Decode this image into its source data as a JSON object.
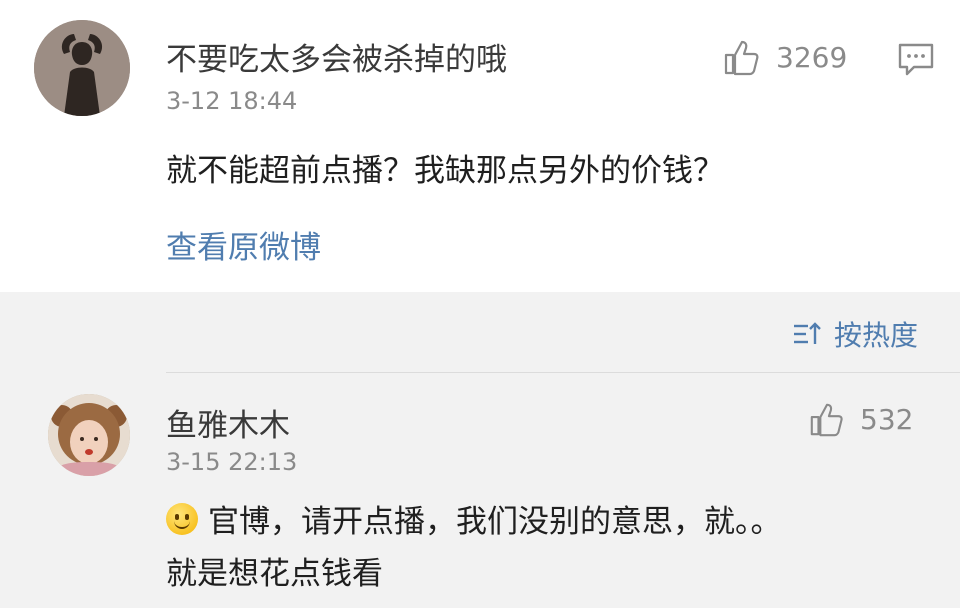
{
  "comment1": {
    "username": "不要吃太多会被杀掉的哦",
    "timestamp": "3-12 18:44",
    "likes": "3269",
    "text": "就不能超前点播？我缺那点另外的价钱？",
    "view_original_link": "查看原微博"
  },
  "sort": {
    "label": "按热度"
  },
  "comment2": {
    "username": "鱼雅木木",
    "timestamp": "3-15 22:13",
    "likes": "532",
    "text_line1": "官博，请开点播，我们没别的意思，就。。",
    "text_line2": "就是想花点钱看",
    "emoji": "smile-emoji"
  },
  "icons": {
    "like": "thumbs-up-icon",
    "comment": "comment-icon",
    "sort": "sort-icon"
  },
  "colors": {
    "link": "#507daf",
    "meta": "#8a8a8a",
    "background_section": "#f2f2f2"
  }
}
